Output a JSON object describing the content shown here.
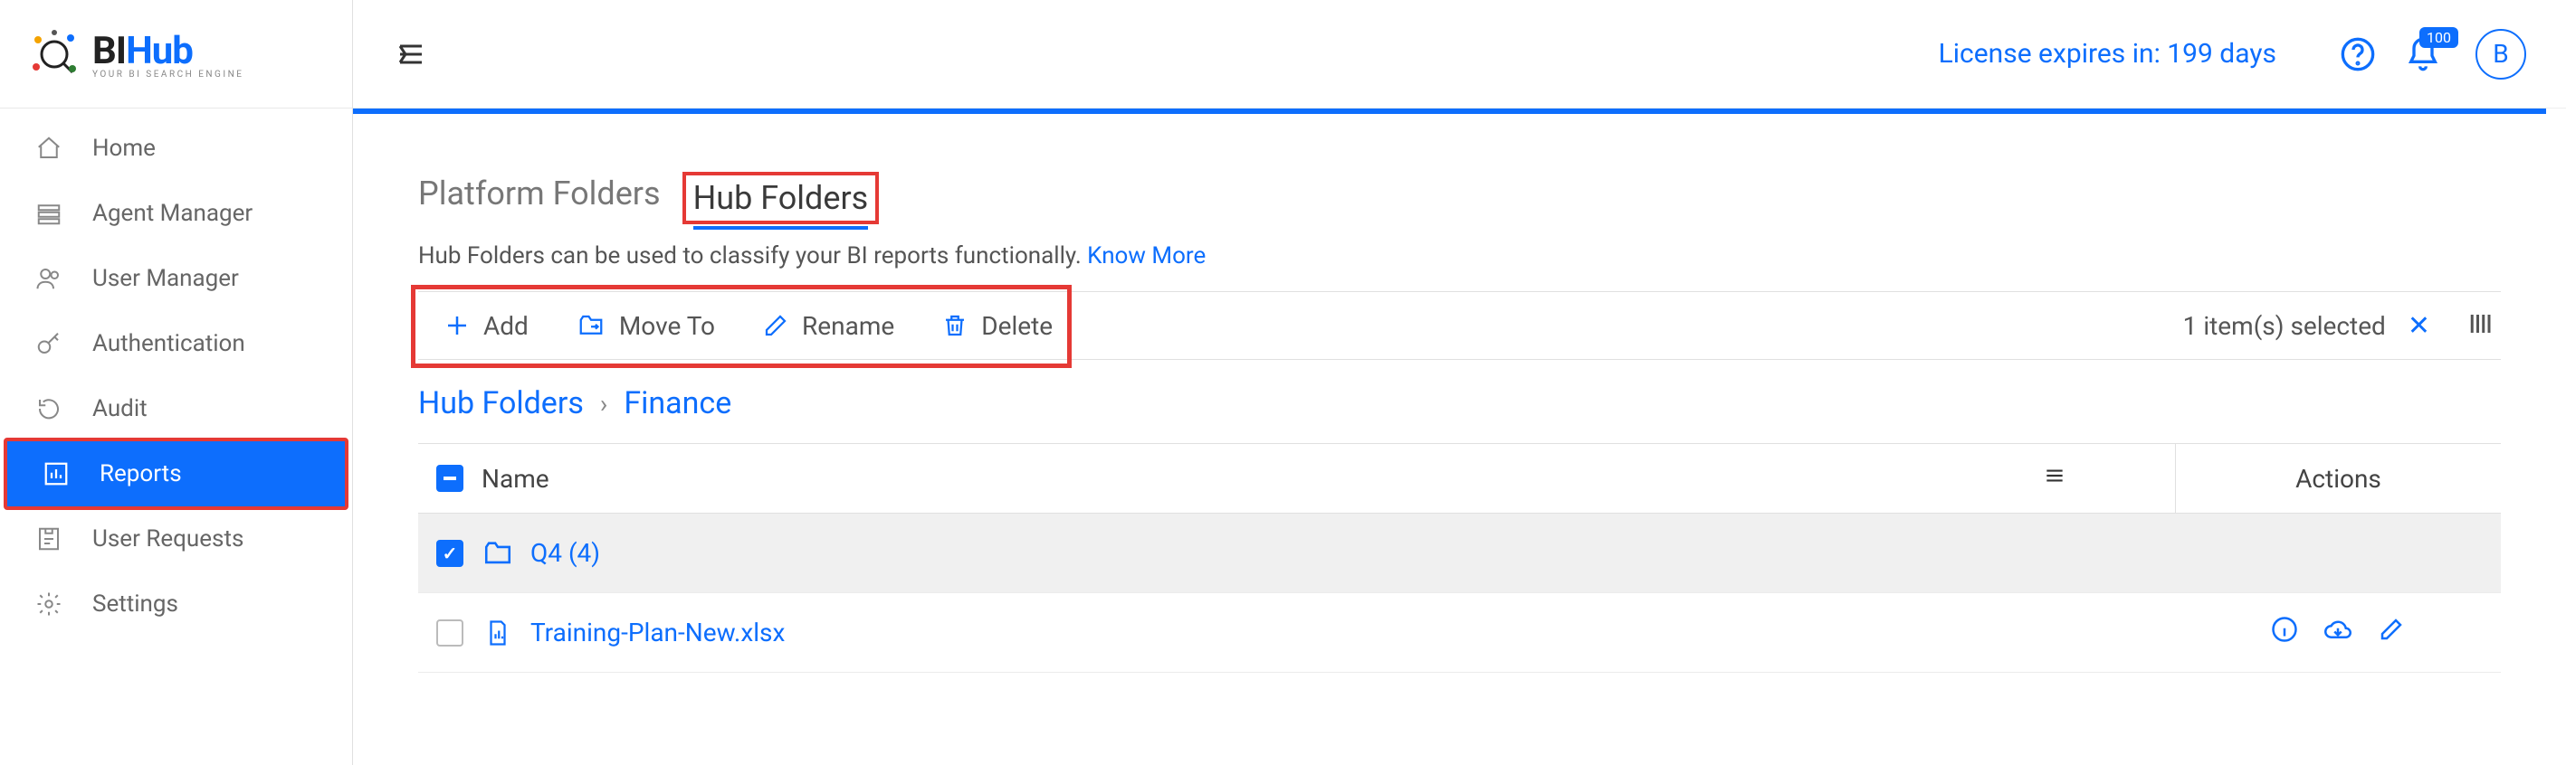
{
  "brand": {
    "bi": "BI",
    "hub": "Hub",
    "tagline": "YOUR BI SEARCH ENGINE"
  },
  "sidebar": {
    "items": [
      {
        "label": "Home"
      },
      {
        "label": "Agent Manager"
      },
      {
        "label": "User Manager"
      },
      {
        "label": "Authentication"
      },
      {
        "label": "Audit"
      },
      {
        "label": "Reports"
      },
      {
        "label": "User Requests"
      },
      {
        "label": "Settings"
      }
    ]
  },
  "header": {
    "license_text": "License expires in: 199 days",
    "notification_count": "100",
    "avatar_initial": "B"
  },
  "tabs": {
    "platform": "Platform Folders",
    "hub": "Hub Folders"
  },
  "desc_text": "Hub Folders can be used to classify your BI reports functionally. ",
  "know_more": "Know More",
  "toolbar": {
    "add": "Add",
    "move_to": "Move To",
    "rename": "Rename",
    "delete": "Delete",
    "selected_text": "1 item(s) selected"
  },
  "breadcrumb": {
    "root": "Hub Folders",
    "current": "Finance"
  },
  "table": {
    "name_header": "Name",
    "actions_header": "Actions",
    "rows": [
      {
        "name": "Q4 (4)",
        "type": "folder",
        "selected": true
      },
      {
        "name": "Training-Plan-New.xlsx",
        "type": "file",
        "selected": false
      }
    ]
  }
}
